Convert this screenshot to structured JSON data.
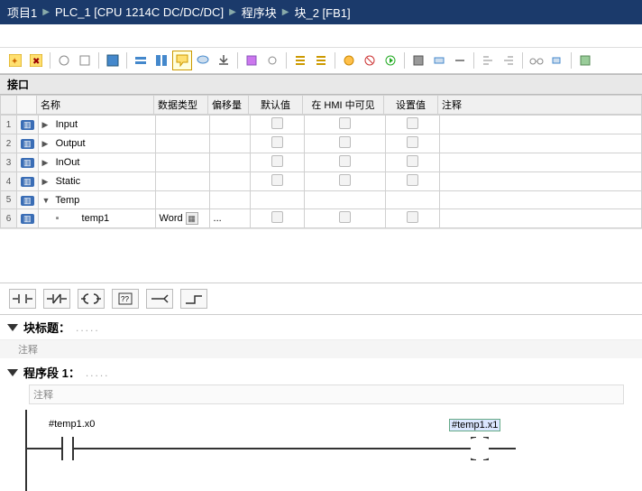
{
  "breadcrumb": {
    "proj": "项目1",
    "plc": "PLC_1 [CPU 1214C DC/DC/DC]",
    "blocks": "程序块",
    "block": "块_2 [FB1]"
  },
  "sections": {
    "interface": "接口"
  },
  "columns": {
    "name": "名称",
    "dtype": "数据类型",
    "offset": "偏移量",
    "default": "默认值",
    "hmi": "在 HMI 中可见",
    "setval": "设置值",
    "comment": "注释"
  },
  "rows": [
    {
      "num": "1",
      "expand": "▶",
      "name": "Input",
      "dtype": "",
      "check": true
    },
    {
      "num": "2",
      "expand": "▶",
      "name": "Output",
      "dtype": "",
      "check": true
    },
    {
      "num": "3",
      "expand": "▶",
      "name": "InOut",
      "dtype": "",
      "check": true
    },
    {
      "num": "4",
      "expand": "▶",
      "name": "Static",
      "dtype": "",
      "check": true
    },
    {
      "num": "5",
      "expand": "▼",
      "name": "Temp",
      "dtype": "",
      "check": false
    },
    {
      "num": "6",
      "expand": "",
      "name": "temp1",
      "dtype": "Word",
      "indent": true,
      "offset": "...",
      "check": true,
      "leaf": true
    }
  ],
  "block_title_label": "块标题：",
  "block_title_dots": ".....",
  "comment_word": "注释",
  "network_label": "程序段 1：",
  "network_dots": ".....",
  "tags": {
    "contact": "#temp1.x0",
    "coil": "#temp1.x1"
  }
}
